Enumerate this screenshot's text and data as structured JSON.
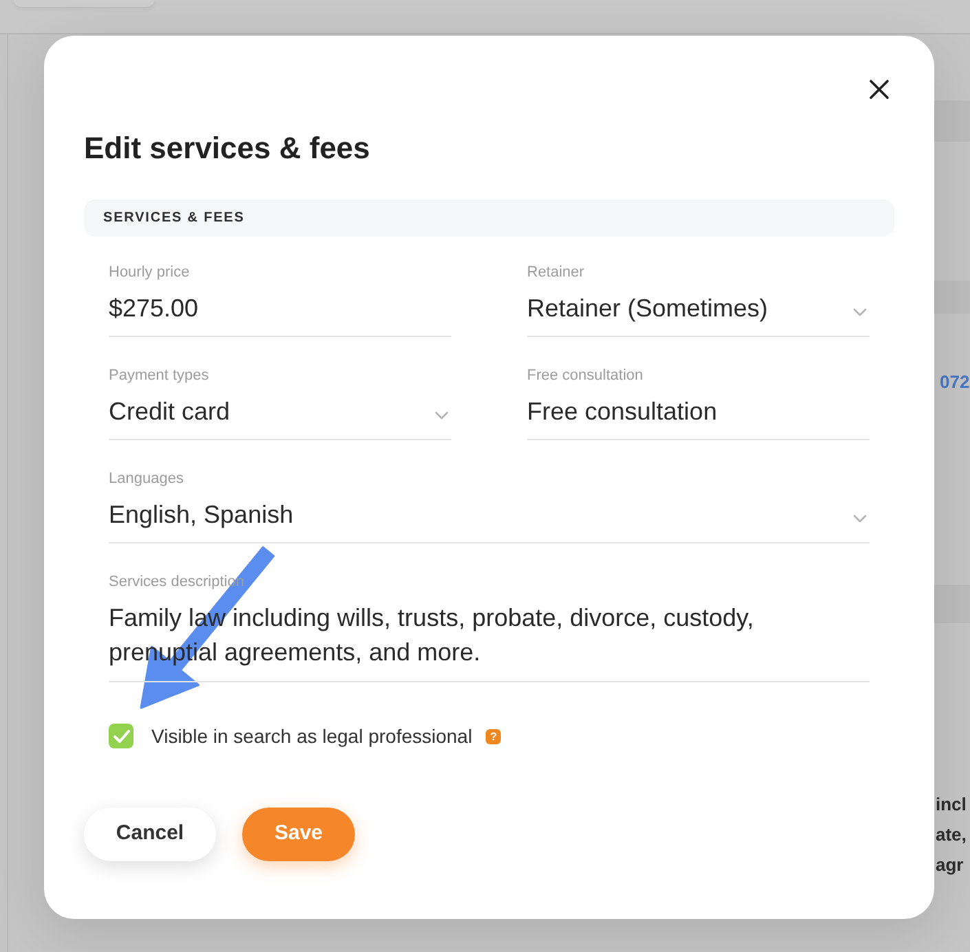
{
  "background": {
    "link_text": "072",
    "text_lines": [
      "incl",
      "ate,",
      "agr"
    ]
  },
  "dialog": {
    "title": "Edit services & fees",
    "section_title": "SERVICES & FEES",
    "rows": [
      [
        {
          "label": "Hourly price",
          "value": "$275.00",
          "kind": "text"
        },
        {
          "label": "Retainer",
          "value": "Retainer (Sometimes)",
          "kind": "select"
        }
      ],
      [
        {
          "label": "Payment types",
          "value": "Credit card",
          "kind": "select"
        },
        {
          "label": "Free consultation",
          "value": "Free consultation",
          "kind": "text"
        }
      ],
      [
        {
          "label": "Languages",
          "value": "English, Spanish",
          "kind": "select"
        }
      ],
      [
        {
          "label": "Services description",
          "value": "Family law including wills, trusts, probate, divorce, custody, prenuptial agreements, and more.",
          "kind": "textarea"
        }
      ]
    ],
    "checkbox": {
      "label": "Visible in search as legal professional",
      "checked": true,
      "help_icon": "?"
    },
    "buttons": [
      {
        "label": "Cancel",
        "kind": "secondary"
      },
      {
        "label": "Save",
        "kind": "primary"
      }
    ]
  }
}
